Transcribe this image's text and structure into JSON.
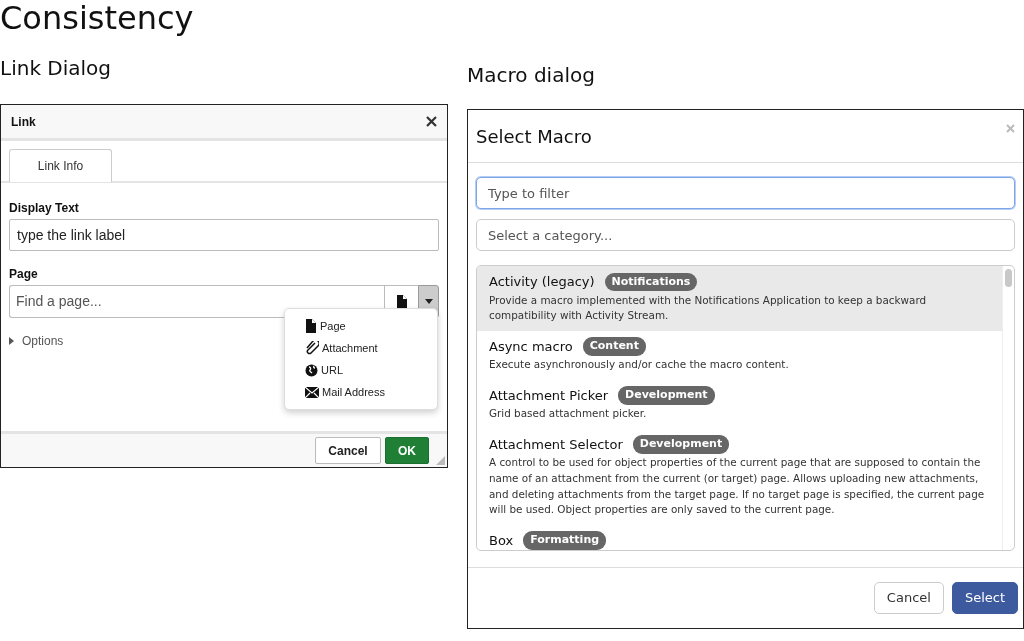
{
  "page_title": "Consistency",
  "link_dialog": {
    "heading": "Link Dialog",
    "title": "Link",
    "tabs": [
      {
        "label": "Link Info",
        "selected": true
      }
    ],
    "display_field": {
      "label": "Display Text",
      "value": "type the link label"
    },
    "page_field": {
      "label": "Page",
      "placeholder": "Find a page..."
    },
    "options": {
      "label": "Options",
      "expanded": false
    },
    "menu_items": [
      {
        "kind": "page",
        "label": "Page"
      },
      {
        "kind": "attachment",
        "label": "Attachment"
      },
      {
        "kind": "url",
        "label": "URL"
      },
      {
        "kind": "mail",
        "label": "Mail Address"
      }
    ],
    "buttons": [
      {
        "kind": "secondary",
        "label": "Cancel"
      },
      {
        "kind": "primary",
        "label": "OK"
      }
    ]
  },
  "macro_dialog": {
    "heading": "Macro dialog",
    "title": "Select Macro",
    "filter": {
      "placeholder": "Type to filter"
    },
    "category": {
      "placeholder": "Select a category..."
    },
    "macros": [
      {
        "name": "Activity (legacy)",
        "category": "Notifications",
        "description": "Provide a macro implemented with the Notifications Application to keep a backward compatibility with Activity Stream.",
        "selected": true
      },
      {
        "name": "Async macro",
        "category": "Content",
        "description": "Execute asynchronously and/or cache the macro content.",
        "selected": false
      },
      {
        "name": "Attachment Picker",
        "category": "Development",
        "description": "Grid based attachment picker.",
        "selected": false
      },
      {
        "name": "Attachment Selector",
        "category": "Development",
        "description": "A control to be used for object properties of the current page that are supposed to contain the name of an attachment from the current (or target) page. Allows uploading new attachments, and deleting attachments from the target page. If no target page is specified, the current page will be used. Object properties are only saved to the current page.",
        "selected": false
      },
      {
        "name": "Box",
        "category": "Formatting",
        "selected": false
      }
    ],
    "buttons": [
      {
        "kind": "secondary",
        "label": "Cancel"
      },
      {
        "kind": "primary",
        "label": "Select"
      }
    ]
  }
}
